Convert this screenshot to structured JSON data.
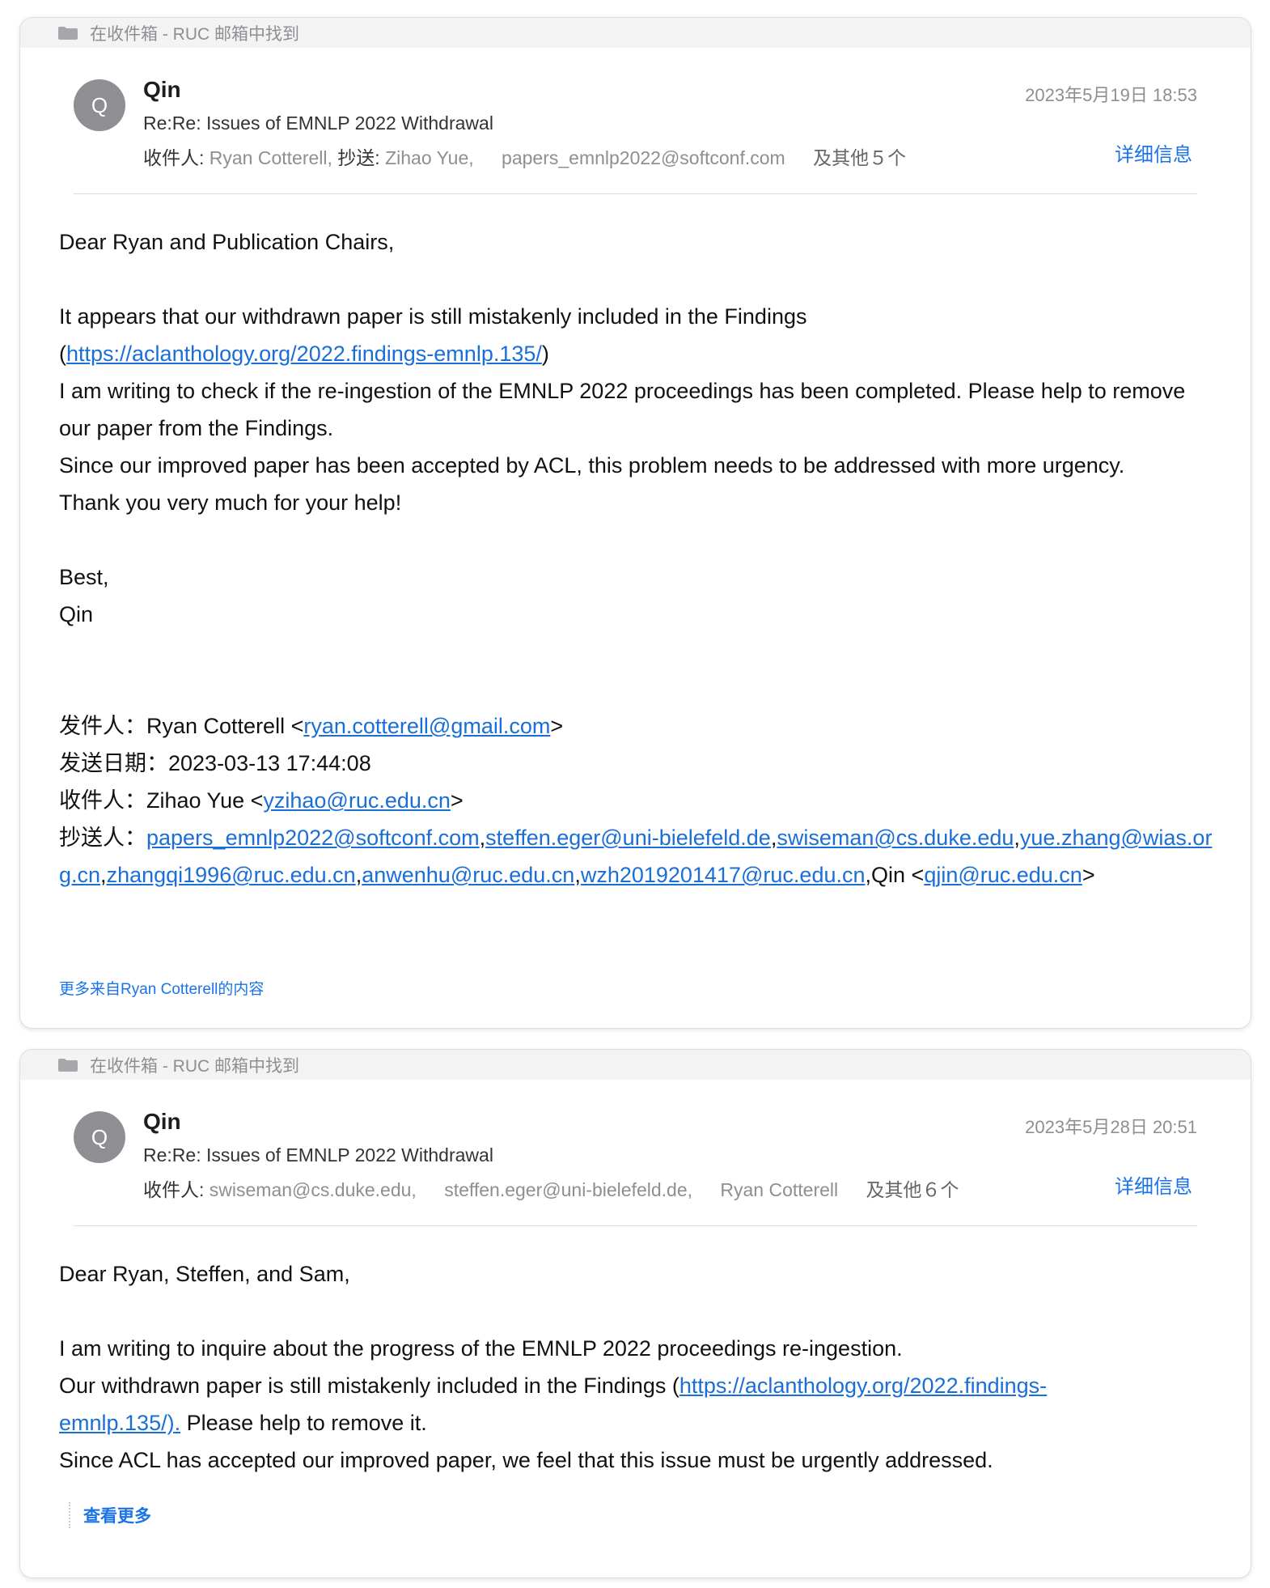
{
  "emails": [
    {
      "found_in": "在收件箱 - RUC 邮箱中找到",
      "avatar_letter": "Q",
      "sender": "Qin",
      "date": "2023年5月19日 18:53",
      "subject": "Re:Re: Issues of EMNLP 2022 Withdrawal",
      "to_label": "收件人:",
      "to": "Ryan Cotterell,",
      "cc_label": "抄送:",
      "cc_1": "Zihao Yue,",
      "cc_2": "papers_emnlp2022@softconf.com",
      "others": "及其他５个",
      "details_link": "详细信息",
      "greeting": "Dear Ryan and Publication Chairs,",
      "para_1a": "It appears that our withdrawn paper is still mistakenly included in the Findings",
      "para_1_link": "https://aclanthology.org/2022.findings-emnlp.135/",
      "para_2": "I am writing to check if the re-ingestion of the EMNLP 2022 proceedings has been completed. Please help to remove our paper from the Findings.",
      "para_3": "Since our improved paper has been accepted by ACL, this problem needs to be addressed with more urgency.",
      "para_4": "Thank you very much for your help!",
      "signoff": "Best,",
      "signature": "Qin",
      "quoted": {
        "from_label": "发件人：Ryan Cotterell <",
        "from_email": "ryan.cotterell@gmail.com",
        "sent_label": "发送日期：2023-03-13 17:44:08",
        "to_label": "收件人：Zihao Yue <",
        "to_email": "yzihao@ruc.edu.cn",
        "cc_label": "抄送人：",
        "cc_emails": [
          "papers_emnlp2022@softconf.com",
          "steffen.eger@uni-bielefeld.de",
          "swiseman@cs.duke.edu",
          "yue.zhang@wias.org.cn",
          "zhangqi1996@ruc.edu.cn",
          "anwenhu@ruc.edu.cn",
          "wzh2019201417@ruc.edu.cn"
        ],
        "cc_last_name": "Qin <",
        "cc_last_email": "qjin@ruc.edu.cn"
      },
      "more_from": "更多来自Ryan Cotterell的内容"
    },
    {
      "found_in": "在收件箱 - RUC 邮箱中找到",
      "avatar_letter": "Q",
      "sender": "Qin",
      "date": "2023年5月28日 20:51",
      "subject": "Re:Re: Issues of EMNLP 2022 Withdrawal",
      "to_label": "收件人:",
      "to_1": "swiseman@cs.duke.edu,",
      "to_2": "steffen.eger@uni-bielefeld.de,",
      "to_3": "Ryan Cotterell",
      "others": "及其他６个",
      "details_link": "详细信息",
      "greeting": "Dear Ryan, Steffen, and Sam,",
      "para_1": "I am writing to inquire about the progress of the EMNLP 2022 proceedings re-ingestion.",
      "para_2a": "Our withdrawn paper is still mistakenly included in the Findings (",
      "para_2_link": "https://aclanthology.org/2022.findings-emnlp.135/).",
      "para_2b": " Please help to remove it.",
      "para_3": "Since ACL has accepted our improved paper, we feel that this issue must be urgently addressed.",
      "see_more": "查看更多"
    }
  ],
  "colors": {
    "link": "#1a6ed8",
    "accent": "#1a73e8",
    "muted": "#8e8e93",
    "avatar": "#8e8e93"
  },
  "icons": {
    "found_in": "folder-icon"
  }
}
